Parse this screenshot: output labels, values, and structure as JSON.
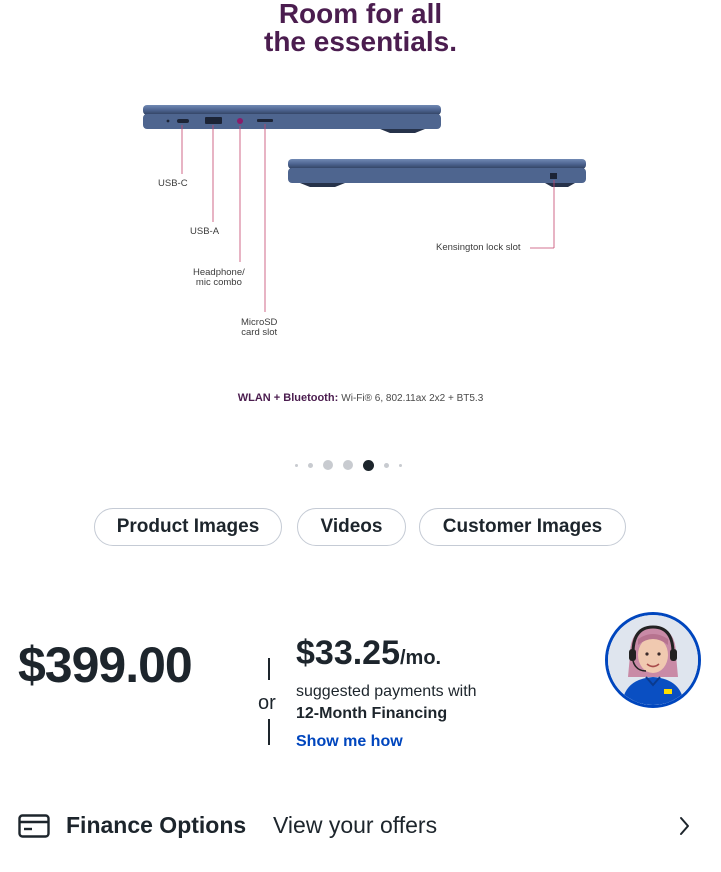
{
  "headline": {
    "line1": "Room for all",
    "line2": "the essentials."
  },
  "ports": {
    "usb_c": "USB-C",
    "usb_a": "USB-A",
    "headphone": "Headphone/\nmic combo",
    "microsd": "MicroSD\ncard slot",
    "kensington": "Kensington lock slot"
  },
  "spec": {
    "label": "WLAN + Bluetooth:",
    "value": "Wi-Fi® 6, 802.11ax 2x2 + BT5.3"
  },
  "carousel": {
    "total": 7,
    "active_index": 4
  },
  "tabs": {
    "product_images": "Product Images",
    "videos": "Videos",
    "customer_images": "Customer Images"
  },
  "pricing": {
    "price": "$399.00",
    "or": "or",
    "monthly": "$33.25",
    "per": "/mo.",
    "suggested": "suggested payments with",
    "financing": "12-Month Financing",
    "show_me_how": "Show me how"
  },
  "finance": {
    "label": "Finance Options",
    "link": "View your offers"
  },
  "colors": {
    "headline": "#4b1d4f",
    "link": "#0046be",
    "laptop": "#4a5f85",
    "text": "#1d252c"
  },
  "icons": {
    "card": "credit-card-icon",
    "chevron": "chevron-right-icon",
    "avatar": "agent-avatar"
  }
}
